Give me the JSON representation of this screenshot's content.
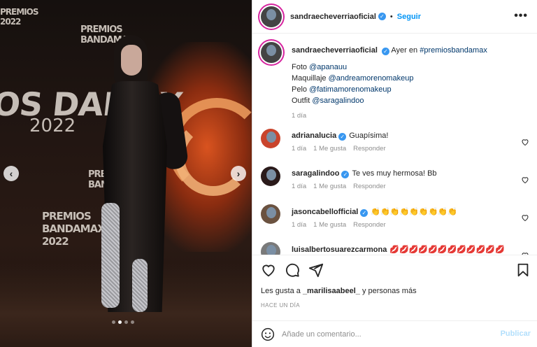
{
  "post": {
    "author": "sandraecheverriaoficial",
    "follow_label": "Seguir",
    "more_icon": "more-horizontal-icon",
    "media": {
      "slide_count": 4,
      "active_slide": 2,
      "brand": {
        "big": "BANDAMAX",
        "year": "2022",
        "small": "PREMIOS",
        "small2": "PREMIOS\nBANDAMAX",
        "small3": "PREMIOS\nBANDAMAX\n2022",
        "small4": "PREMIOS\n2022"
      }
    },
    "caption": {
      "author": "sandraecheverriaoficial",
      "text_prefix": "Ayer en ",
      "hashtag": "#premiosbandamax",
      "lines": [
        {
          "label": "Foto ",
          "mention": "@apanauu"
        },
        {
          "label": "Maquillaje ",
          "mention": "@andreamorenomakeup"
        },
        {
          "label": "Pelo ",
          "mention": "@fatimamorenomakeup"
        },
        {
          "label": "Outfit ",
          "mention": "@saragalindoo"
        }
      ],
      "time": "1 día"
    },
    "comments": [
      {
        "user": "adrianalucia",
        "verified": true,
        "text": "Guapísima!",
        "time": "1 día",
        "likes": "1 Me gusta",
        "reply": "Responder"
      },
      {
        "user": "saragalindoo",
        "verified": true,
        "text": "Te ves muy hermosa! Bb",
        "time": "1 día",
        "likes": "1 Me gusta",
        "reply": "Responder"
      },
      {
        "user": "jasoncabellofficial",
        "verified": true,
        "text": "👏👏👏👏👏👏👏👏👏",
        "time": "1 día",
        "likes": "1 Me gusta",
        "reply": "Responder"
      },
      {
        "user": "luisalbertosuarezcarmona",
        "verified": false,
        "text": "💋💋💋💋💋💋💋💋💋💋💋💋",
        "time": "",
        "likes": "",
        "reply": ""
      }
    ],
    "likes": {
      "prefix": "Les gusta a ",
      "user": "_marilisaabeel_",
      "suffix": " y personas más"
    },
    "time_ago": "HACE UN DÍA",
    "add_comment": {
      "placeholder": "Añade un comentario...",
      "publish_label": "Publicar"
    }
  }
}
